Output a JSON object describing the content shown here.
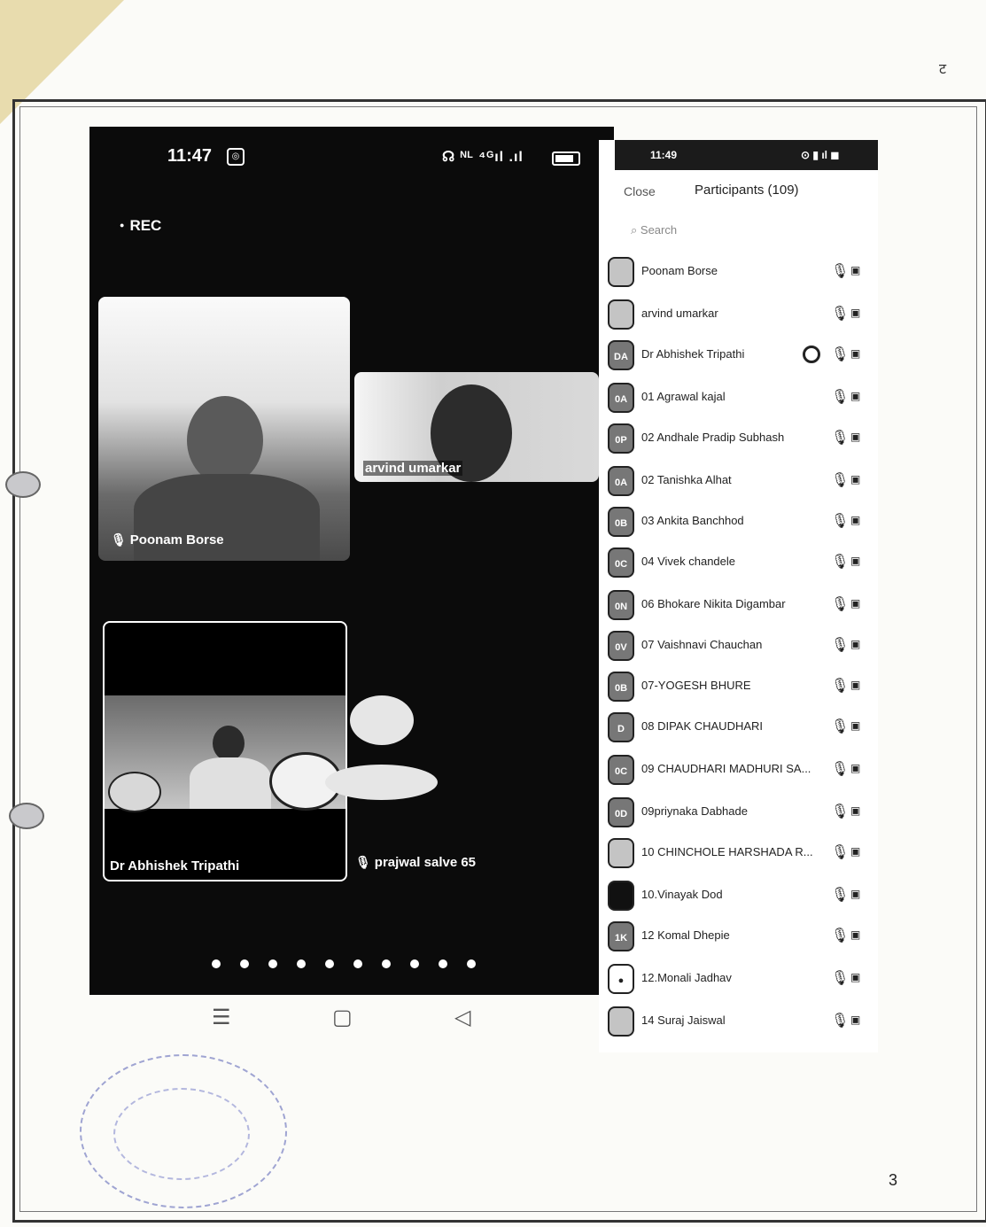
{
  "page_mark": "ट",
  "phone": {
    "time": "11:47",
    "status_icons": "☊ ᴺᴸ ⁴ᴳıl .ıl",
    "rec_label": "REC"
  },
  "tiles": [
    {
      "name": "Poonam Borse",
      "muted": true
    },
    {
      "name": "arvind umarkar",
      "muted": false
    },
    {
      "name": "Dr Abhishek Tripathi",
      "muted": false
    },
    {
      "name": "prajwal salve 65",
      "muted": true
    }
  ],
  "page_dots": 10,
  "nav": {
    "menu": "☰",
    "home": "▢",
    "back": "◁"
  },
  "panel": {
    "time": "11:49",
    "close_label": "Close",
    "title": "Participants (109)",
    "search_placeholder": "Search",
    "participants": [
      {
        "initials": "",
        "name": "Poonam Borse",
        "photo": true
      },
      {
        "initials": "",
        "name": "arvind umarkar",
        "photo": true
      },
      {
        "initials": "DA",
        "name": "Dr Abhishek Tripathi",
        "extra": true
      },
      {
        "initials": "0A",
        "name": "01 Agrawal kajal"
      },
      {
        "initials": "0P",
        "name": "02 Andhale Pradip Subhash"
      },
      {
        "initials": "0A",
        "name": "02 Tanishka Alhat"
      },
      {
        "initials": "0B",
        "name": "03 Ankita Banchhod"
      },
      {
        "initials": "0C",
        "name": "04 Vivek chandele"
      },
      {
        "initials": "0N",
        "name": "06 Bhokare Nikita Digambar"
      },
      {
        "initials": "0V",
        "name": "07 Vaishnavi Chauchan"
      },
      {
        "initials": "0B",
        "name": "07-YOGESH BHURE"
      },
      {
        "initials": "D",
        "name": "08 DIPAK CHAUDHARI"
      },
      {
        "initials": "0C",
        "name": "09 CHAUDHARI MADHURI SA..."
      },
      {
        "initials": "0D",
        "name": "09priynaka Dabhade"
      },
      {
        "initials": "",
        "name": "10 CHINCHOLE HARSHADA R...",
        "photo": true
      },
      {
        "initials": "",
        "name": "10.Vinayak Dod",
        "dark": true
      },
      {
        "initials": "1K",
        "name": "12 Komal Dhepie"
      },
      {
        "initials": "",
        "name": "12.Monali Jadhav",
        "person": true
      },
      {
        "initials": "",
        "name": "14 Suraj Jaiswal",
        "photo": true
      }
    ]
  },
  "page_number": "3"
}
